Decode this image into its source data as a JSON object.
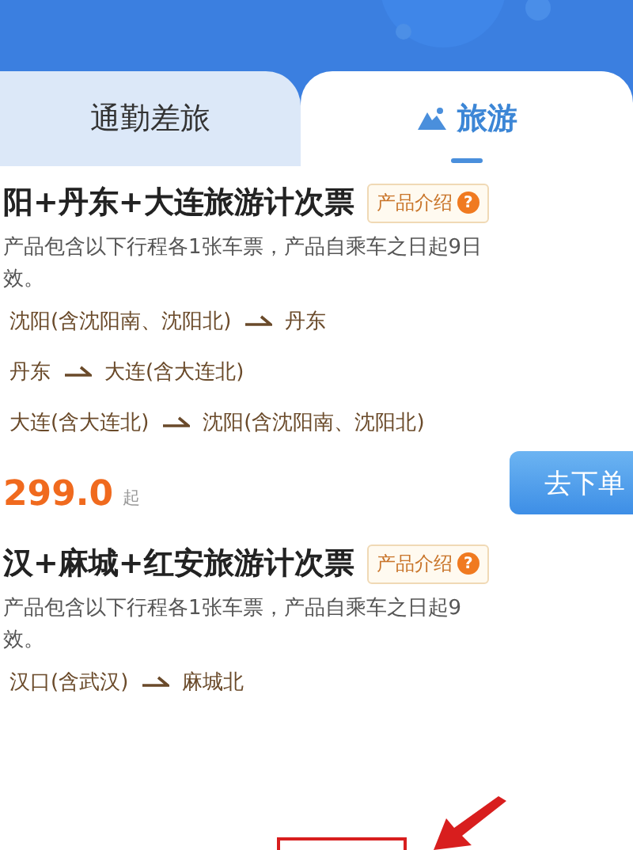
{
  "tabs": [
    {
      "label": "通勤差旅",
      "selected": false
    },
    {
      "label": "旅游",
      "selected": true
    }
  ],
  "products": [
    {
      "title": "阳+丹东+大连旅游计次票",
      "intro": "产品介绍",
      "help": "?",
      "desc_lines": [
        "产品包含以下行程各1张车票，产品自乘车之日起9日",
        "效。"
      ],
      "routes": [
        {
          "from": "沈阳(含沈阳南、沈阳北)",
          "to": "丹东"
        },
        {
          "from": "丹东",
          "to": "大连(含大连北)"
        },
        {
          "from": "大连(含大连北)",
          "to": "沈阳(含沈阳南、沈阳北)"
        }
      ],
      "price": "299.0",
      "price_suffix": "起",
      "button": "去下单"
    },
    {
      "title": "汉+麻城+红安旅游计次票",
      "intro": "产品介绍",
      "help": "?",
      "desc_lines": [
        "产品包含以下行程各1张车票，产品自乘车之日起9",
        "效。"
      ],
      "routes": [
        {
          "from": "汉口(含武汉)",
          "to": "麻城北"
        }
      ]
    }
  ]
}
